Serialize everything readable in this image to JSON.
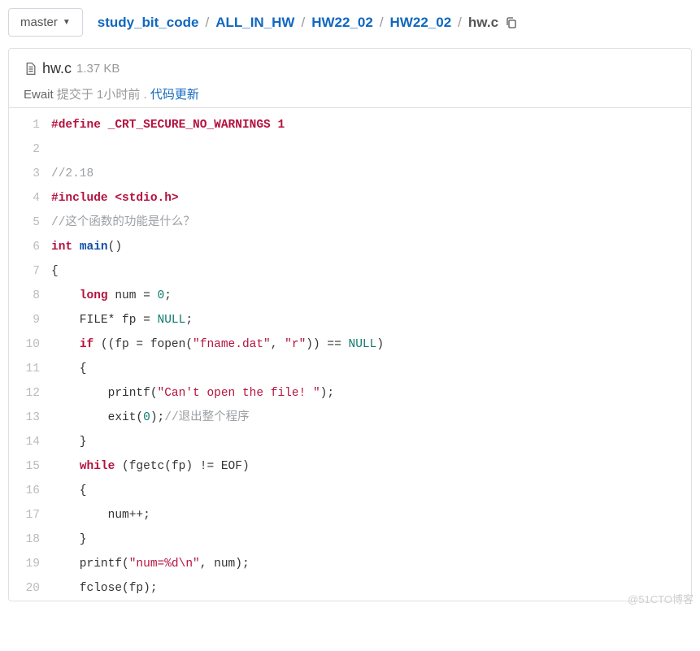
{
  "branch": {
    "label": "master"
  },
  "breadcrumb": {
    "items": [
      "study_bit_code",
      "ALL_IN_HW",
      "HW22_02",
      "HW22_02"
    ],
    "last": "hw.c"
  },
  "file": {
    "name": "hw.c",
    "size": "1.37 KB"
  },
  "commit": {
    "author": "Ewait",
    "action": "提交于",
    "time": "1小时前",
    "dot": ".",
    "message": "代码更新"
  },
  "code": {
    "lines": [
      {
        "n": 1,
        "tokens": [
          {
            "c": "tok-pre",
            "t": "#define _CRT_SECURE_NO_WARNINGS 1"
          }
        ]
      },
      {
        "n": 2,
        "tokens": []
      },
      {
        "n": 3,
        "tokens": [
          {
            "c": "tok-com",
            "t": "//2.18"
          }
        ]
      },
      {
        "n": 4,
        "tokens": [
          {
            "c": "tok-pre",
            "t": "#include <stdio.h>"
          }
        ]
      },
      {
        "n": 5,
        "tokens": [
          {
            "c": "tok-com",
            "t": "//这个函数的功能是什么？"
          }
        ]
      },
      {
        "n": 6,
        "tokens": [
          {
            "c": "tok-kw",
            "t": "int"
          },
          {
            "c": "tok-op",
            "t": " "
          },
          {
            "c": "tok-fn",
            "t": "main"
          },
          {
            "c": "tok-op",
            "t": "()"
          }
        ]
      },
      {
        "n": 7,
        "tokens": [
          {
            "c": "tok-op",
            "t": "{"
          }
        ]
      },
      {
        "n": 8,
        "tokens": [
          {
            "c": "tok-op",
            "t": "    "
          },
          {
            "c": "tok-kw",
            "t": "long"
          },
          {
            "c": "tok-op",
            "t": " num = "
          },
          {
            "c": "tok-num",
            "t": "0"
          },
          {
            "c": "tok-op",
            "t": ";"
          }
        ]
      },
      {
        "n": 9,
        "tokens": [
          {
            "c": "tok-op",
            "t": "    FILE* fp = "
          },
          {
            "c": "tok-num",
            "t": "NULL"
          },
          {
            "c": "tok-op",
            "t": ";"
          }
        ]
      },
      {
        "n": 10,
        "tokens": [
          {
            "c": "tok-op",
            "t": "    "
          },
          {
            "c": "tok-kw",
            "t": "if"
          },
          {
            "c": "tok-op",
            "t": " ((fp = fopen("
          },
          {
            "c": "tok-str",
            "t": "\"fname.dat\""
          },
          {
            "c": "tok-op",
            "t": ", "
          },
          {
            "c": "tok-str",
            "t": "\"r\""
          },
          {
            "c": "tok-op",
            "t": ")) == "
          },
          {
            "c": "tok-num",
            "t": "NULL"
          },
          {
            "c": "tok-op",
            "t": ")"
          }
        ]
      },
      {
        "n": 11,
        "tokens": [
          {
            "c": "tok-op",
            "t": "    {"
          }
        ]
      },
      {
        "n": 12,
        "tokens": [
          {
            "c": "tok-op",
            "t": "        printf("
          },
          {
            "c": "tok-str",
            "t": "\"Can't open the file! \""
          },
          {
            "c": "tok-op",
            "t": ");"
          }
        ]
      },
      {
        "n": 13,
        "tokens": [
          {
            "c": "tok-op",
            "t": "        exit("
          },
          {
            "c": "tok-num",
            "t": "0"
          },
          {
            "c": "tok-op",
            "t": ");"
          },
          {
            "c": "tok-com",
            "t": "//退出整个程序"
          }
        ]
      },
      {
        "n": 14,
        "tokens": [
          {
            "c": "tok-op",
            "t": "    }"
          }
        ]
      },
      {
        "n": 15,
        "tokens": [
          {
            "c": "tok-op",
            "t": "    "
          },
          {
            "c": "tok-kw",
            "t": "while"
          },
          {
            "c": "tok-op",
            "t": " (fgetc(fp) != EOF)"
          }
        ]
      },
      {
        "n": 16,
        "tokens": [
          {
            "c": "tok-op",
            "t": "    {"
          }
        ]
      },
      {
        "n": 17,
        "tokens": [
          {
            "c": "tok-op",
            "t": "        num++;"
          }
        ]
      },
      {
        "n": 18,
        "tokens": [
          {
            "c": "tok-op",
            "t": "    }"
          }
        ]
      },
      {
        "n": 19,
        "tokens": [
          {
            "c": "tok-op",
            "t": "    printf("
          },
          {
            "c": "tok-str",
            "t": "\"num=%d\\n\""
          },
          {
            "c": "tok-op",
            "t": ", num);"
          }
        ]
      },
      {
        "n": 20,
        "tokens": [
          {
            "c": "tok-op",
            "t": "    fclose(fp);"
          }
        ]
      }
    ]
  },
  "watermark": "@51CTO博客"
}
